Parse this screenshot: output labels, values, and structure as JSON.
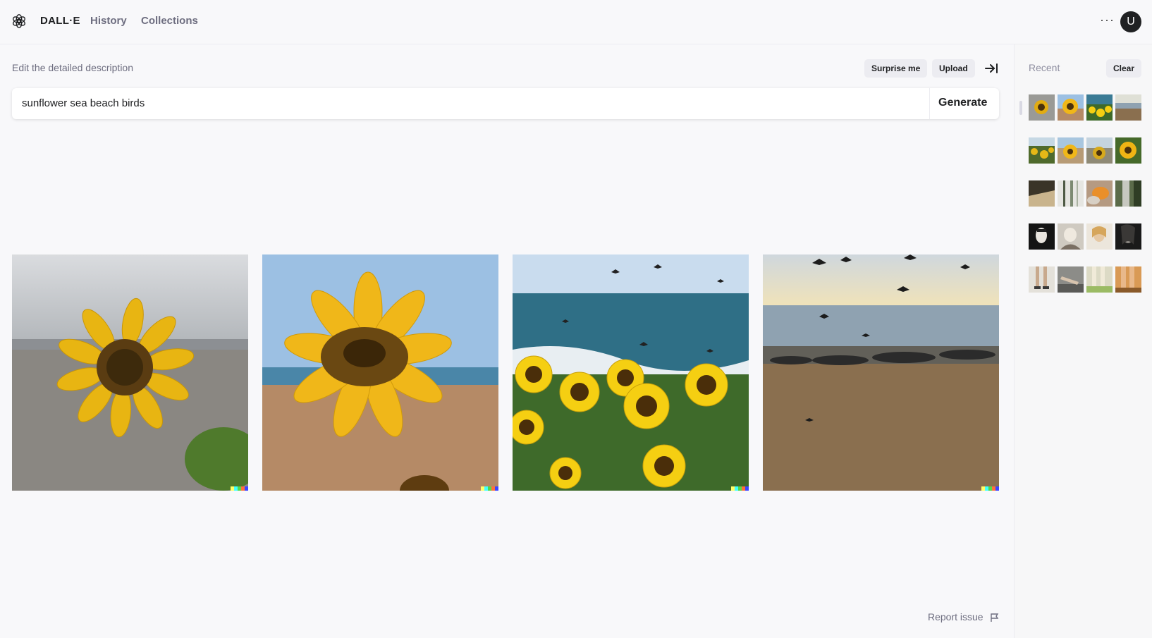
{
  "header": {
    "brand": "DALL·E",
    "nav": [
      "History",
      "Collections"
    ],
    "more_icon": "ellipsis-icon",
    "avatar_initial": "U"
  },
  "editor": {
    "label": "Edit the detailed description",
    "surprise_label": "Surprise me",
    "upload_label": "Upload",
    "expand_icon": "arrow-right-to-bar-icon",
    "prompt_value": "sunflower sea beach birds",
    "generate_label": "Generate"
  },
  "results": {
    "images": [
      {
        "alt": "sunflower on grey sand beach"
      },
      {
        "alt": "sunflower close-up on beach with blue sky"
      },
      {
        "alt": "field of sunflowers by waves with birds"
      },
      {
        "alt": "birds flying over beach at sunset"
      }
    ],
    "signature_colors": [
      "#ffff66",
      "#42ffff",
      "#51da4c",
      "#ff6e3c",
      "#3c46ff"
    ]
  },
  "footer": {
    "report_label": "Report issue",
    "report_icon": "flag-icon"
  },
  "sidebar": {
    "title": "Recent",
    "clear_label": "Clear",
    "thumbnail_rows": 5,
    "thumbnails_per_row": 4
  }
}
